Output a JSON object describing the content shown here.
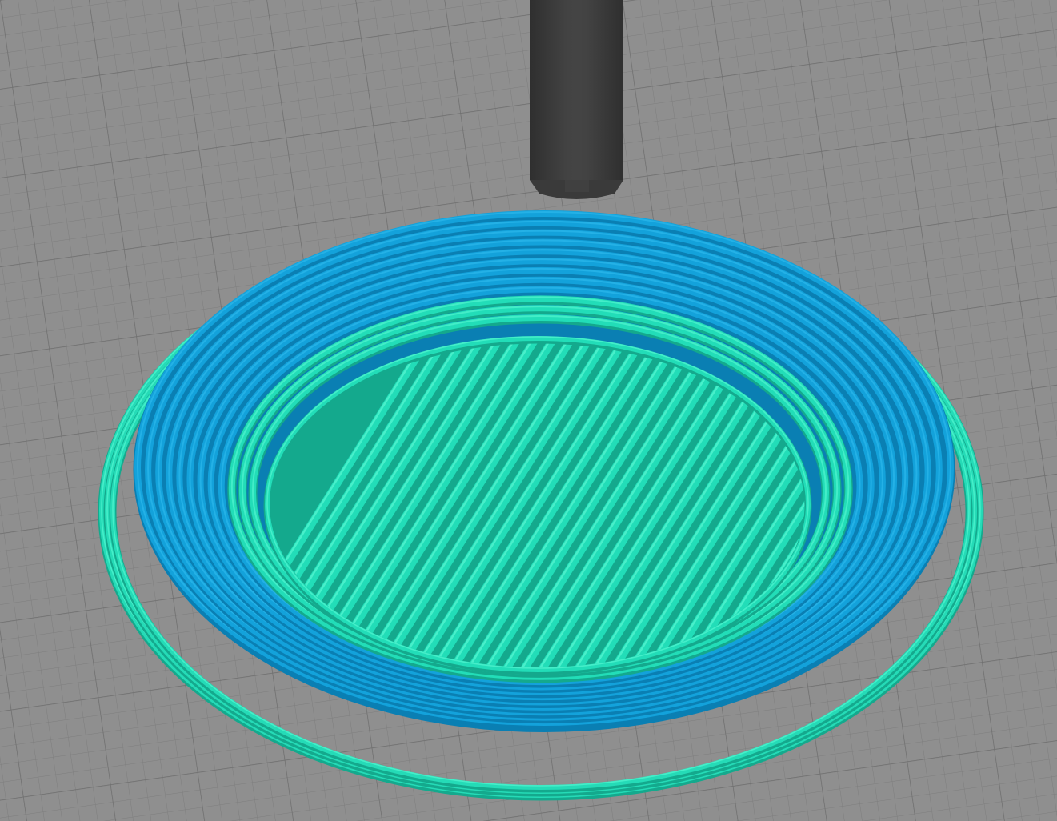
{
  "viewport": {
    "name": "3d-slice-preview",
    "background_color": "#8f8f8f",
    "grid_color": "#7d7d7d",
    "grid_major_color": "#6e6e6e"
  },
  "nozzle": {
    "icon": "print-nozzle-icon",
    "colors": {
      "dark": "#2f2f2f",
      "mid": "#3a3a3a",
      "light": "#484848"
    }
  },
  "extrusion": {
    "wall_color": "#13a2db",
    "wall_highlight": "#2bb5ea",
    "wall_shadow": "#0a7fb3",
    "infill_color": "#22ddb8",
    "infill_highlight": "#4ff2cd",
    "infill_shadow": "#14a98d",
    "skirt_color": "#25dbb7"
  },
  "layers": {
    "wall_loops": 12,
    "skirt_loops": 3,
    "infill_lines": 34
  }
}
